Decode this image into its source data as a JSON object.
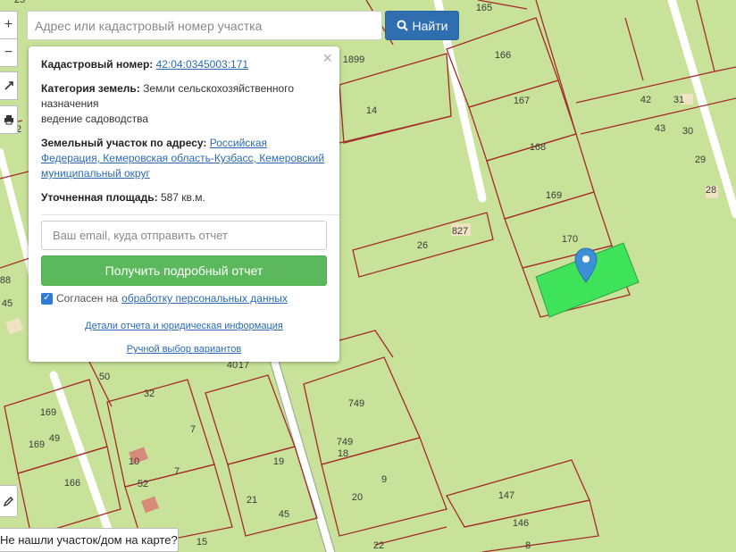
{
  "map": {
    "colors": {
      "background": "#c8e29a",
      "parcel_border": "#a52a2a",
      "selected_parcel": "#3ee35a",
      "road": "#ffffff",
      "marker": "#3d8fd6"
    },
    "labels": [
      "165",
      "166",
      "167",
      "168",
      "169",
      "170",
      "1899",
      "14",
      "42",
      "31",
      "43",
      "30",
      "29",
      "28",
      "26",
      "827",
      "749",
      "749",
      "9",
      "20",
      "147",
      "146",
      "8",
      "22",
      "21",
      "45",
      "19",
      "15",
      "7",
      "7",
      "32",
      "169",
      "169",
      "49",
      "166",
      "52",
      "50",
      "40",
      "17",
      "10",
      "88",
      "45",
      "18",
      "25",
      "42"
    ]
  },
  "controls": {
    "zoom_in": "+",
    "zoom_out": "−",
    "fullscreen_icon": "expand-icon",
    "print_icon": "print-icon",
    "draw_icon": "pencil-icon"
  },
  "search": {
    "placeholder": "Адрес или кадастровый номер участка",
    "button_label": "Найти",
    "button_icon": "search-icon"
  },
  "popup": {
    "cadastral_label": "Кадастровый номер:",
    "cadastral_value": "42:04:0345003:171",
    "category_label": "Категория земель:",
    "category_value": "Земли сельскохозяйственного назначения",
    "category_use": "ведение садоводства",
    "address_label": "Земельный участок по адресу:",
    "address_value": "Российская Федерация, Кемеровская область-Кузбасс, Кемеровский муниципальный округ",
    "area_label": "Уточненная площадь:",
    "area_value": "587 кв.м.",
    "email_placeholder": "Ваш email, куда отправить отчет",
    "report_button": "Получить подробный отчет",
    "consent_text": "Согласен на",
    "consent_link": "обработку персональных данных",
    "details_link": "Детали отчета и юридическая информация",
    "manual_link": "Ручной выбор вариантов",
    "close": "×"
  },
  "footer": {
    "not_found": "Не нашли участок/дом на карте?"
  }
}
